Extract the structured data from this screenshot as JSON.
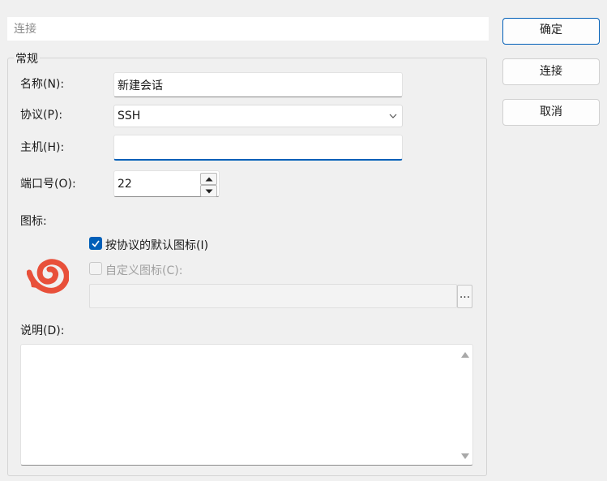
{
  "header": {
    "title": "连接"
  },
  "general": {
    "group_title": "常规",
    "name_label": "名称(N):",
    "name_value": "新建会话",
    "protocol_label": "协议(P):",
    "protocol_value": "SSH",
    "host_label": "主机(H):",
    "host_value": "",
    "port_label": "端口号(O):",
    "port_value": "22",
    "icon_label": "图标:",
    "icon_name": "xshell-swirl-logo",
    "default_icon_label": "按协议的默认图标(I)",
    "default_icon_checked": true,
    "custom_icon_label": "自定义图标(C):",
    "custom_icon_checked": false,
    "custom_icon_path": "",
    "browse_label": "...",
    "description_label": "说明(D):",
    "description_value": ""
  },
  "buttons": {
    "ok": "确定",
    "connect": "连接",
    "cancel": "取消"
  },
  "colors": {
    "accent": "#005fb8",
    "logo": "#e8503a",
    "background": "#f0f0f0"
  }
}
